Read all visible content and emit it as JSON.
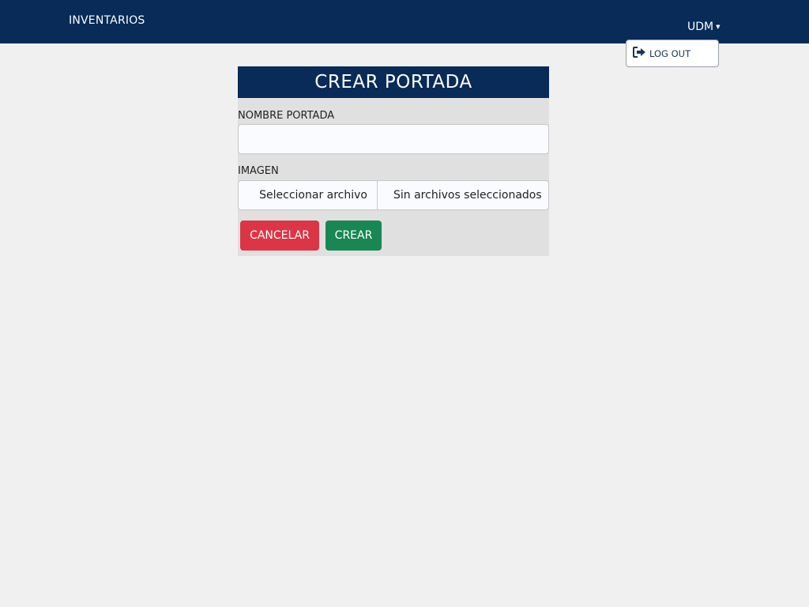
{
  "navbar": {
    "brand": "INVENTARIOS",
    "user_label": "UDM",
    "dropdown": {
      "logout_label": "LOG OUT",
      "icon": "logout-icon"
    }
  },
  "form": {
    "title": "CREAR PORTADA",
    "name_label": "NOMBRE PORTADA",
    "name_value": "",
    "image_label": "IMAGEN",
    "file_button": "Seleccionar archivo",
    "file_status": "Sin archivos seleccionados",
    "cancel_label": "CANCELAR",
    "create_label": "CREAR"
  },
  "colors": {
    "navbar": "#082b57",
    "cancel": "#dc3545",
    "create": "#198754",
    "card_bg": "#e0e0e0",
    "page_bg": "#f0f0f0"
  }
}
